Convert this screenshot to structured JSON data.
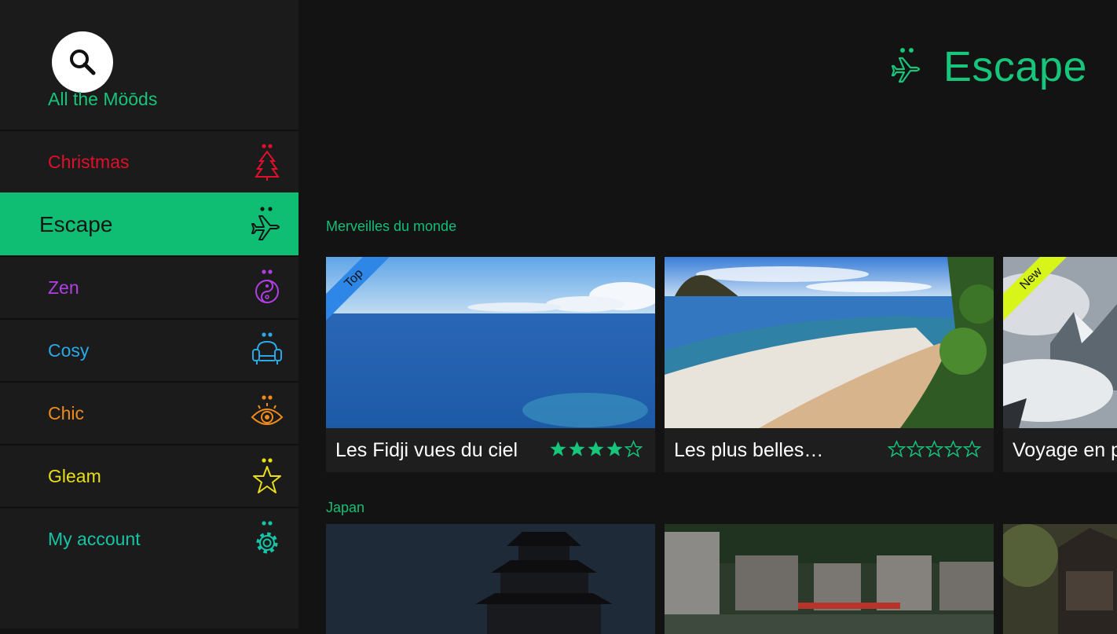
{
  "sidebar": {
    "header": "All the Möōds",
    "items": [
      {
        "label": "Christmas",
        "color": "#e0102a",
        "icon": "tree-icon"
      },
      {
        "label": "Escape",
        "color": "#161616",
        "icon": "plane-icon",
        "active": true
      },
      {
        "label": "Zen",
        "color": "#b040e6",
        "icon": "yin-yang-icon"
      },
      {
        "label": "Cosy",
        "color": "#2aa9e6",
        "icon": "armchair-icon"
      },
      {
        "label": "Chic",
        "color": "#ef8a1c",
        "icon": "eye-icon"
      },
      {
        "label": "Gleam",
        "color": "#e8df16",
        "icon": "star-icon"
      },
      {
        "label": "My account",
        "color": "#16c4a5",
        "icon": "gear-icon"
      }
    ]
  },
  "header": {
    "title": "Escape",
    "icon": "plane-icon",
    "accent": "#17c57b"
  },
  "sections": [
    {
      "label": "Merveilles du monde",
      "cards": [
        {
          "title": "Les Fidji vues du ciel",
          "rating": 4,
          "max": 5,
          "ribbon": "Top",
          "ribbon_color": "#2e86e6"
        },
        {
          "title": "Les plus belles…",
          "rating": 0,
          "max": 5
        },
        {
          "title": "Voyage en p",
          "ribbon": "New",
          "ribbon_color": "#d8f51a"
        }
      ]
    },
    {
      "label": "Japan"
    }
  ]
}
